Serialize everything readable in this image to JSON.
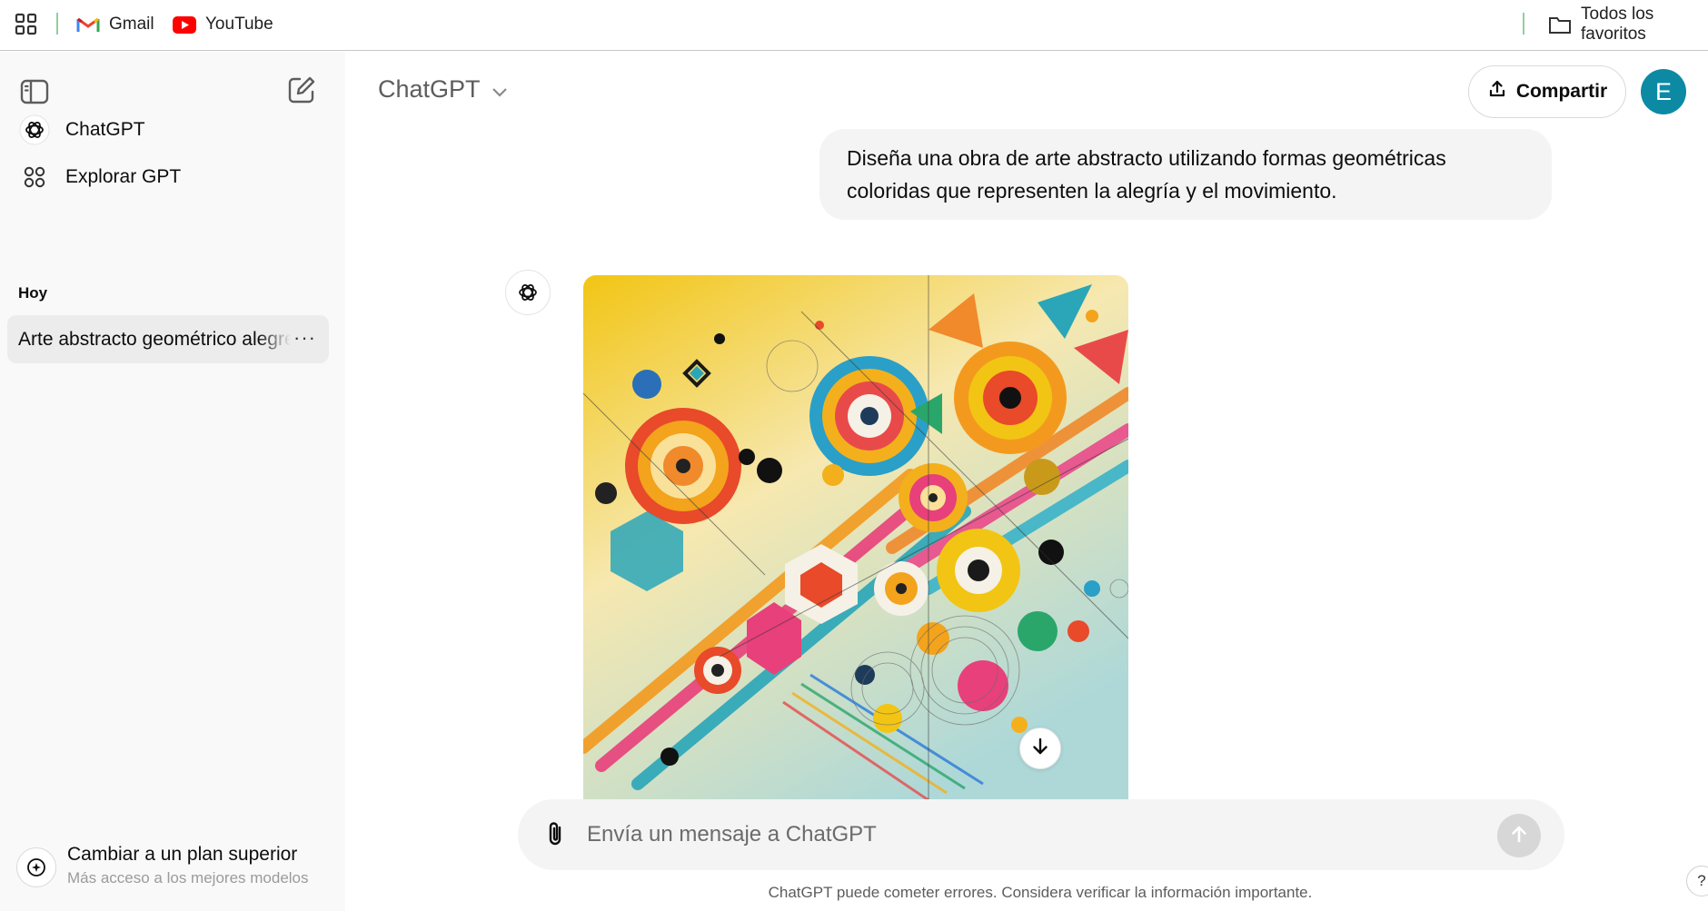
{
  "bookmarks": {
    "items": [
      {
        "label": "Gmail",
        "icon": "gmail-icon"
      },
      {
        "label": "YouTube",
        "icon": "youtube-icon"
      }
    ],
    "all_bookmarks_label": "Todos los favoritos"
  },
  "sidebar": {
    "nav": [
      {
        "label": "ChatGPT",
        "icon": "openai-logo-icon"
      },
      {
        "label": "Explorar GPT",
        "icon": "grid-dots-icon"
      }
    ],
    "section_today": "Hoy",
    "chats": [
      {
        "title": "Arte abstracto geométrico alegre",
        "more": "···"
      }
    ],
    "upgrade": {
      "title": "Cambiar a un plan superior",
      "subtitle": "Más acceso a los mejores modelos"
    }
  },
  "header": {
    "model_label": "ChatGPT",
    "share_label": "Compartir",
    "avatar_initial": "E"
  },
  "conversation": {
    "user_message": "Diseña una obra de arte abstracto utilizando formas geométricas coloridas que representen la alegría y el movimiento."
  },
  "composer": {
    "placeholder": "Envía un mensaje a ChatGPT"
  },
  "footer": {
    "disclaimer": "ChatGPT puede cometer errores. Considera verificar la información importante.",
    "help": "?"
  },
  "colors": {
    "sidebar_bg": "#f9f9f9",
    "active_chat_bg": "#ececec",
    "avatar_bg": "#0c8aa4",
    "bubble_bg": "#f4f4f4"
  }
}
